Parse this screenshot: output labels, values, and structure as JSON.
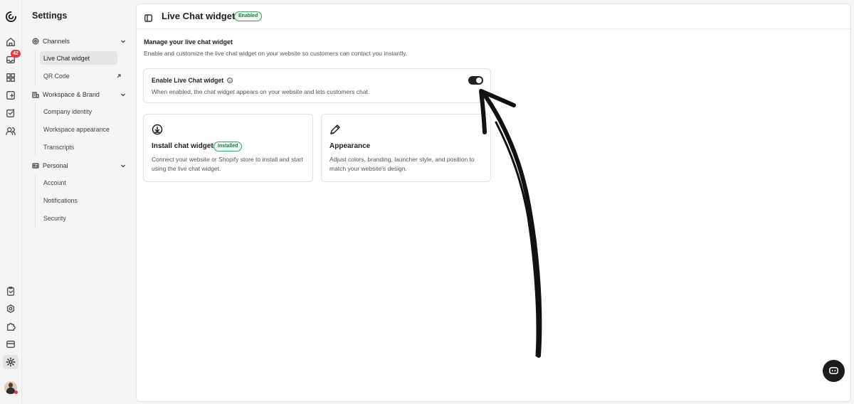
{
  "sidebar": {
    "title": "Settings",
    "sections": [
      {
        "label": "Channels",
        "items": [
          "Live Chat widget",
          "QR Code"
        ]
      },
      {
        "label": "Workspace & Brand",
        "items": [
          "Company identity",
          "Workspace appearance",
          "Transcripts"
        ]
      },
      {
        "label": "Personal",
        "items": [
          "Account",
          "Notifications",
          "Security"
        ]
      }
    ]
  },
  "rail": {
    "inbox_badge": "42"
  },
  "header": {
    "title": "Live Chat widget",
    "status": "Enabled"
  },
  "main": {
    "heading": "Manage your live chat widget",
    "description": "Enable and customize the live chat widget on your website so customers can contact you instantly.",
    "toggle_card": {
      "title": "Enable Live Chat widget",
      "description": "When enabled, the chat widget appears on your website and lets customers chat.",
      "enabled": true
    },
    "cards": [
      {
        "title": "Install chat widget",
        "badge": "Installed",
        "description": "Connect your website or Shopify store to install and start using the live chat widget.",
        "icon": "download-circle-icon"
      },
      {
        "title": "Appearance",
        "badge": "",
        "description": "Adjust colors, branding, launcher style, and position to match your website's design.",
        "icon": "pen-icon"
      }
    ]
  },
  "colors": {
    "accent_green": "#3aa55d",
    "badge_red": "#e5383b",
    "toggle_on": "#222222"
  }
}
